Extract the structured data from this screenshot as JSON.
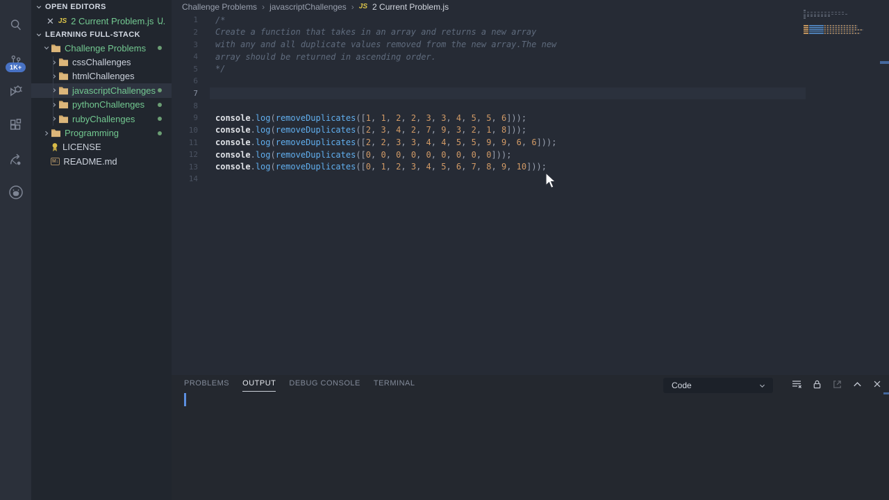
{
  "activity_bar": {
    "scm_badge": "1K+",
    "icons": [
      "search-icon",
      "source-control-icon",
      "run-debug-icon",
      "extensions-icon",
      "live-share-icon",
      "github-icon"
    ]
  },
  "sidebar": {
    "open_editors": {
      "header": "OPEN EDITORS",
      "file": {
        "icon_label": "JS",
        "name": "2 Current Problem.js",
        "ellipsis": "...",
        "git_badge": "U"
      }
    },
    "workspace_header": "LEARNING FULL-STACK",
    "tree": [
      {
        "label": "Challenge Problems",
        "kind": "folder",
        "indent": 1,
        "expanded": true,
        "green": true,
        "dot": true,
        "selected": false
      },
      {
        "label": "cssChallenges",
        "kind": "folder",
        "indent": 2,
        "expanded": false,
        "green": false,
        "dot": false,
        "selected": false
      },
      {
        "label": "htmlChallenges",
        "kind": "folder",
        "indent": 2,
        "expanded": false,
        "green": false,
        "dot": false,
        "selected": false
      },
      {
        "label": "javascriptChallenges",
        "kind": "folder",
        "indent": 2,
        "expanded": false,
        "green": true,
        "dot": true,
        "selected": true
      },
      {
        "label": "pythonChallenges",
        "kind": "folder",
        "indent": 2,
        "expanded": false,
        "green": true,
        "dot": true,
        "selected": false
      },
      {
        "label": "rubyChallenges",
        "kind": "folder",
        "indent": 2,
        "expanded": false,
        "green": true,
        "dot": true,
        "selected": false
      },
      {
        "label": "Programming",
        "kind": "folder",
        "indent": 1,
        "expanded": false,
        "green": true,
        "dot": true,
        "selected": false
      },
      {
        "label": "LICENSE",
        "kind": "license",
        "indent": 1,
        "expanded": false,
        "green": false,
        "dot": false,
        "selected": false
      },
      {
        "label": "README.md",
        "kind": "markdown",
        "indent": 1,
        "expanded": false,
        "green": false,
        "dot": false,
        "selected": false
      }
    ]
  },
  "breadcrumb": {
    "items": [
      "Challenge Problems",
      "javascriptChallenges"
    ],
    "separator": "›",
    "file_icon": "JS",
    "file_name": "2 Current Problem.js"
  },
  "editor": {
    "code_lines": [
      {
        "n": 1,
        "type": "comment",
        "text": "/*"
      },
      {
        "n": 2,
        "type": "comment",
        "text": "Create a function that takes in an array and returns a new array"
      },
      {
        "n": 3,
        "type": "comment",
        "text": "with any and all duplicate values removed from the new array.The new"
      },
      {
        "n": 4,
        "type": "comment",
        "text": "array should be returned in ascending order."
      },
      {
        "n": 5,
        "type": "comment",
        "text": "*/"
      },
      {
        "n": 6,
        "type": "blank"
      },
      {
        "n": 7,
        "type": "blank",
        "current": true
      },
      {
        "n": 8,
        "type": "blank"
      },
      {
        "n": 9,
        "type": "log",
        "object": "console",
        "method": "log",
        "call": "removeDuplicates",
        "args": [
          1,
          1,
          2,
          2,
          3,
          3,
          4,
          5,
          5,
          6
        ]
      },
      {
        "n": 10,
        "type": "log",
        "object": "console",
        "method": "log",
        "call": "removeDuplicates",
        "args": [
          2,
          3,
          4,
          2,
          7,
          9,
          3,
          2,
          1,
          8
        ]
      },
      {
        "n": 11,
        "type": "log",
        "object": "console",
        "method": "log",
        "call": "removeDuplicates",
        "args": [
          2,
          2,
          3,
          3,
          4,
          4,
          5,
          5,
          9,
          9,
          6,
          6
        ]
      },
      {
        "n": 12,
        "type": "log",
        "object": "console",
        "method": "log",
        "call": "removeDuplicates",
        "args": [
          0,
          0,
          0,
          0,
          0,
          0,
          0,
          0,
          0
        ]
      },
      {
        "n": 13,
        "type": "log",
        "object": "console",
        "method": "log",
        "call": "removeDuplicates",
        "args": [
          0,
          1,
          2,
          3,
          4,
          5,
          6,
          7,
          8,
          9,
          10
        ]
      },
      {
        "n": 14,
        "type": "blank"
      }
    ]
  },
  "panel": {
    "tabs": [
      {
        "label": "PROBLEMS",
        "active": false
      },
      {
        "label": "OUTPUT",
        "active": true
      },
      {
        "label": "DEBUG CONSOLE",
        "active": false
      },
      {
        "label": "TERMINAL",
        "active": false
      }
    ],
    "channel_select": {
      "value": "Code"
    },
    "action_icons": [
      "clear-output-icon",
      "lock-scroll-icon",
      "open-in-editor-icon",
      "maximize-panel-icon",
      "close-panel-icon"
    ]
  },
  "colors": {
    "function_blue": "#61afef",
    "number_orange": "#d19a66",
    "comment_gray": "#5f6b7d",
    "git_green": "#73c991",
    "badge_blue": "#4872c4",
    "js_yellow": "#ddc64a",
    "editor_bg": "#262b35",
    "sidebar_bg": "#21262e",
    "activitybar_bg": "#2b303a"
  }
}
